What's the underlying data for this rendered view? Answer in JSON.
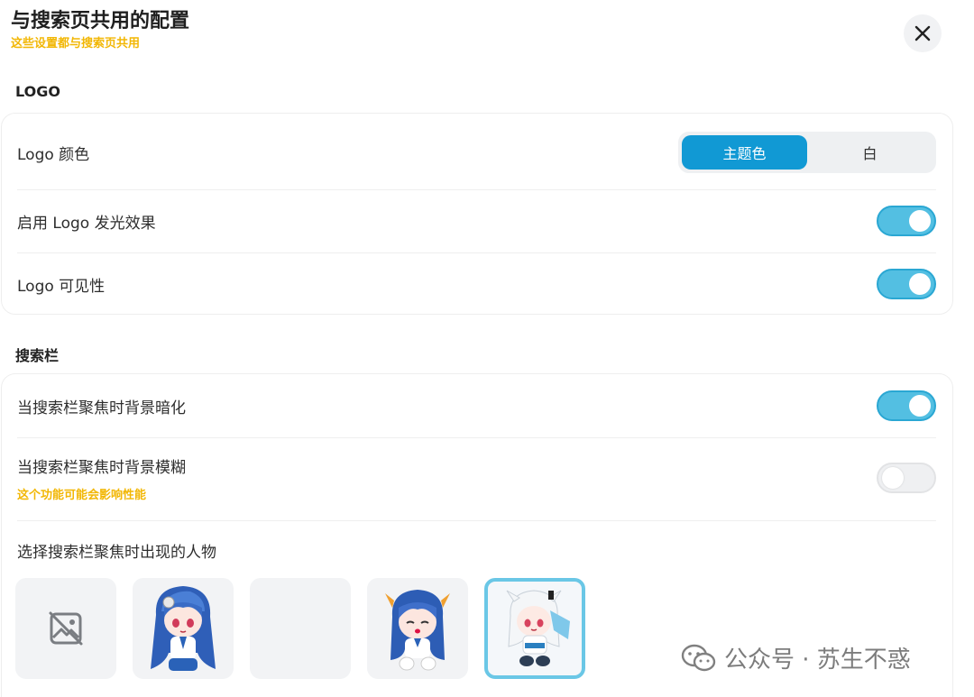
{
  "dialog": {
    "title": "与搜索页共用的配置",
    "subtitle": "这些设置都与搜索页共用"
  },
  "logo_section": {
    "heading": "LOGO",
    "color_label": "Logo 颜色",
    "color_options": [
      "主题色",
      "白"
    ],
    "color_selected": "主题色",
    "glow_label": "启用 Logo 发光效果",
    "glow_enabled": true,
    "visibility_label": "Logo 可见性",
    "visibility_enabled": true
  },
  "search_section": {
    "heading": "搜索栏",
    "dim_label": "当搜索栏聚焦时背景暗化",
    "dim_enabled": true,
    "blur_label": "当搜索栏聚焦时背景模糊",
    "blur_hint": "这个功能可能会影响性能",
    "blur_enabled": false,
    "character_label": "选择搜索栏聚焦时出现的人物",
    "selected_character_index": 4
  },
  "watermark": {
    "text": "公众号 · 苏生不惑"
  },
  "colors": {
    "accent": "#1199d4",
    "toggle_on": "#53bfe2",
    "hint": "#f2b705"
  }
}
